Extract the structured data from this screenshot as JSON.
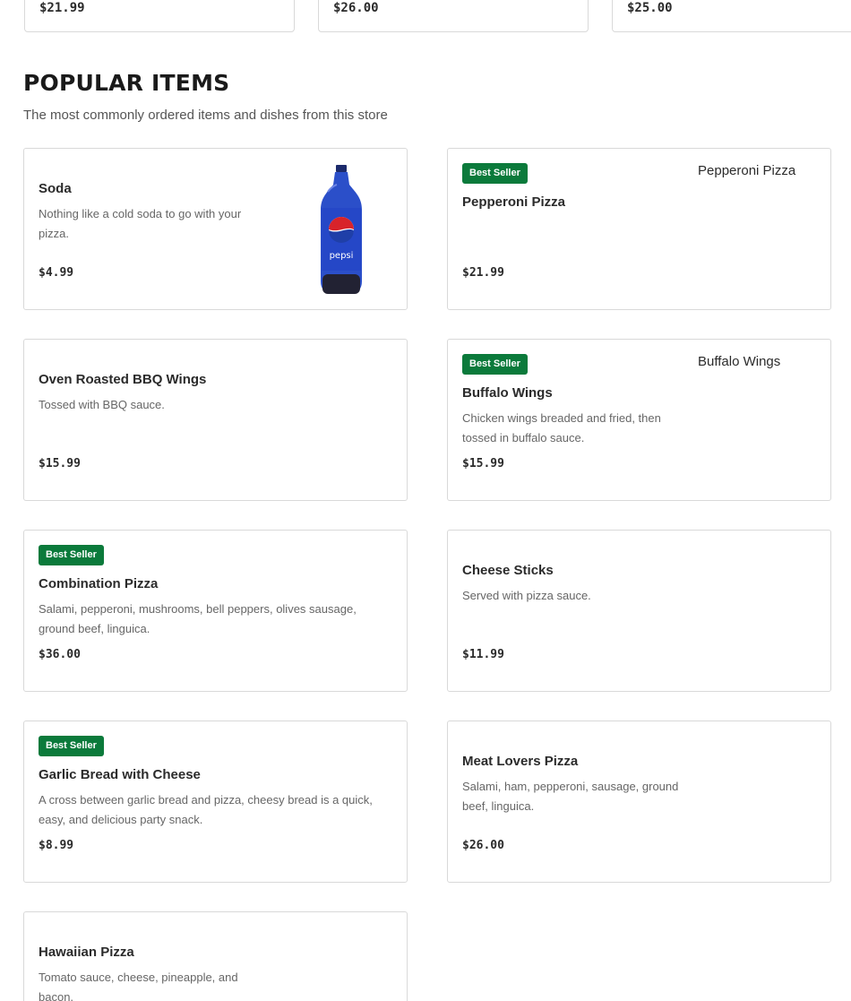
{
  "top_cards": [
    {
      "price": "$21.99"
    },
    {
      "price": "$26.00"
    },
    {
      "price": "$25.00"
    }
  ],
  "section": {
    "title": "POPULAR ITEMS",
    "subtitle": "The most commonly ordered items and dishes from this store"
  },
  "badge_label": "Best Seller",
  "items": [
    {
      "name": "Soda",
      "description": "Nothing like a cold soda to go with your pizza.",
      "price": "$4.99",
      "best_seller": false,
      "image": "pepsi-bottle"
    },
    {
      "name": "Pepperoni Pizza",
      "description": "",
      "price": "$21.99",
      "best_seller": true,
      "image_alt": "Pepperoni Pizza"
    },
    {
      "name": "Oven Roasted BBQ Wings",
      "description": "Tossed with BBQ sauce.",
      "price": "$15.99",
      "best_seller": false
    },
    {
      "name": "Buffalo Wings",
      "description": "Chicken wings breaded and fried, then tossed in buffalo sauce.",
      "price": "$15.99",
      "best_seller": true,
      "image_alt": "Buffalo Wings"
    },
    {
      "name": "Combination Pizza",
      "description": "Salami, pepperoni, mushrooms, bell peppers, olives sausage, ground beef, linguica.",
      "price": "$36.00",
      "best_seller": true
    },
    {
      "name": "Cheese Sticks",
      "description": "Served with pizza sauce.",
      "price": "$11.99",
      "best_seller": false
    },
    {
      "name": "Garlic Bread with Cheese",
      "description": "A cross between garlic bread and pizza, cheesy bread is a quick, easy, and delicious party snack.",
      "price": "$8.99",
      "best_seller": true
    },
    {
      "name": "Meat Lovers Pizza",
      "description": "Salami, ham, pepperoni, sausage, ground beef, linguica.",
      "price": "$26.00",
      "best_seller": false
    },
    {
      "name": "Hawaiian Pizza",
      "description": "Tomato sauce, cheese, pineapple, and bacon.",
      "price": "",
      "best_seller": false
    }
  ],
  "bottle_label": "pepsi",
  "colors": {
    "best_seller_badge": "#0b7a3b",
    "card_border": "#d9d9d9",
    "pepsi_blue": "#2b4fc9"
  }
}
